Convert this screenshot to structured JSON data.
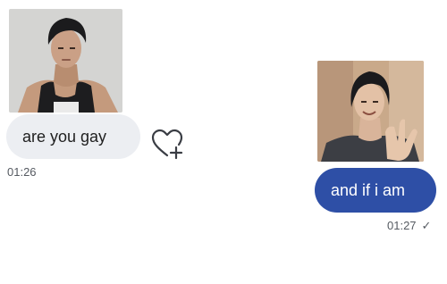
{
  "conversation": {
    "received": {
      "text": "are you gay",
      "time": "01:26"
    },
    "sent": {
      "text": "and if i am",
      "time": "01:27",
      "status_glyph": "✓"
    }
  },
  "icons": {
    "reaction": "heart-plus-icon",
    "read_receipt": "checkmark-icon"
  },
  "colors": {
    "received_bubble": "#eceef2",
    "sent_bubble": "#2e4fa6",
    "timestamp": "#555a61"
  }
}
